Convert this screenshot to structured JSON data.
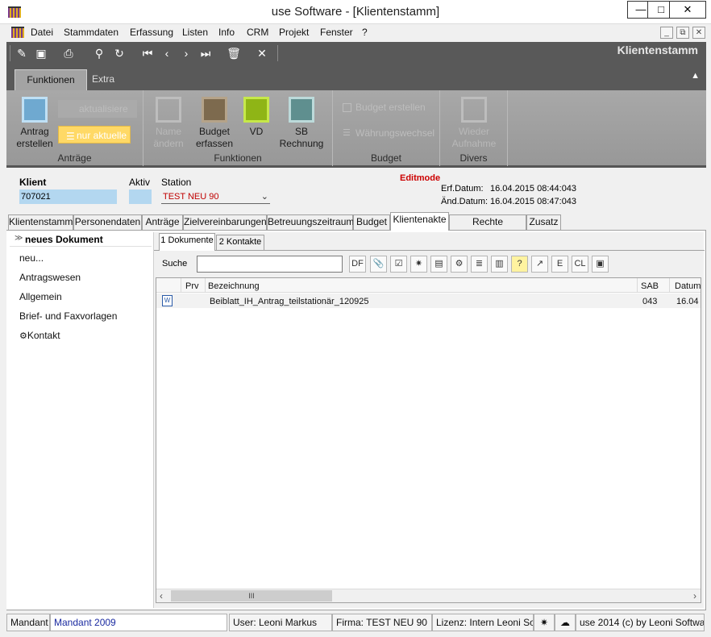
{
  "window": {
    "title": "use Software - [Klientenstamm]"
  },
  "menu": [
    "Datei",
    "Stammdaten",
    "Erfassung",
    "Listen",
    "Info",
    "CRM",
    "Projekt",
    "Fenster",
    "?"
  ],
  "ribbon": {
    "form_title": "Klientenstamm",
    "tabs": [
      "Funktionen",
      "Extra"
    ],
    "groups": {
      "antraege": {
        "label": "Anträge",
        "antrag_line1": "Antrag",
        "antrag_line2": "erstellen",
        "aktualisiere": "aktualisiere",
        "nur_aktuelle": "nur aktuelle"
      },
      "funktionen": {
        "label": "Funktionen",
        "name_line1": "Name",
        "name_line2": "ändern",
        "budget_line1": "Budget",
        "budget_line2": "erfassen",
        "vd": "VD",
        "sb_line1": "SB",
        "sb_line2": "Rechnung"
      },
      "budget": {
        "label": "Budget",
        "budget_erstellen": "Budget erstellen",
        "waehrungswechsel": "Währungswechsel"
      },
      "divers": {
        "label": "Divers",
        "wieder_line1": "Wieder",
        "wieder_line2": "Aufnahme"
      }
    }
  },
  "header": {
    "klient_label": "Klient",
    "klient_value": "707021",
    "aktiv_label": "Aktiv",
    "station_label": "Station",
    "station_value": "TEST NEU 90",
    "editmode": "Editmode",
    "erf_label": "Erf.Datum:",
    "erf_value": "16.04.2015 08:44:043",
    "aend_label": "Änd.Datum:",
    "aend_value": "16.04.2015 08:47:043"
  },
  "tabs": [
    "Klientenstamm",
    "Personendaten",
    "Anträge",
    "Zielvereinbarungen",
    "Betreuungszeitraum",
    "Budget",
    "Klientenakte",
    "Rechte gewähren",
    "Zusatz"
  ],
  "left_panel": {
    "header": "neues Dokument",
    "items": [
      "neu...",
      "Antragswesen",
      "Allgemein",
      "Brief- und Faxvorlagen",
      "Kontakt"
    ]
  },
  "subtabs": [
    "1 Dokumente",
    "2 Kontakte"
  ],
  "search": {
    "label": "Suche",
    "value": ""
  },
  "icon_buttons": {
    "df": "DF",
    "e": "E",
    "cl": "CL"
  },
  "grid": {
    "columns": [
      "Prv",
      "Bezeichnung",
      "SAB",
      "Datum"
    ],
    "rows": [
      {
        "prv": "",
        "bezeichnung": "Beiblatt_IH_Antrag_teilstationär_120925",
        "sab": "043",
        "datum": "16.04"
      }
    ],
    "hscroll_grip": "III"
  },
  "status": {
    "mandant_label": "Mandant",
    "mandant_value": "Mandant 2009",
    "user": "User: Leoni Markus",
    "firma": "Firma: TEST NEU 90",
    "lizenz": "Lizenz: Intern Leoni Soft",
    "copyright": "use 2014 (c) by Leoni Softwa"
  },
  "colors": {
    "accent_blue": "#b3d7f0",
    "editmode_red": "#cc0000",
    "toolbar_dark": "#595959",
    "ribbon_gray": "#a0a0a0",
    "highlight_yellow": "#ffd966"
  }
}
